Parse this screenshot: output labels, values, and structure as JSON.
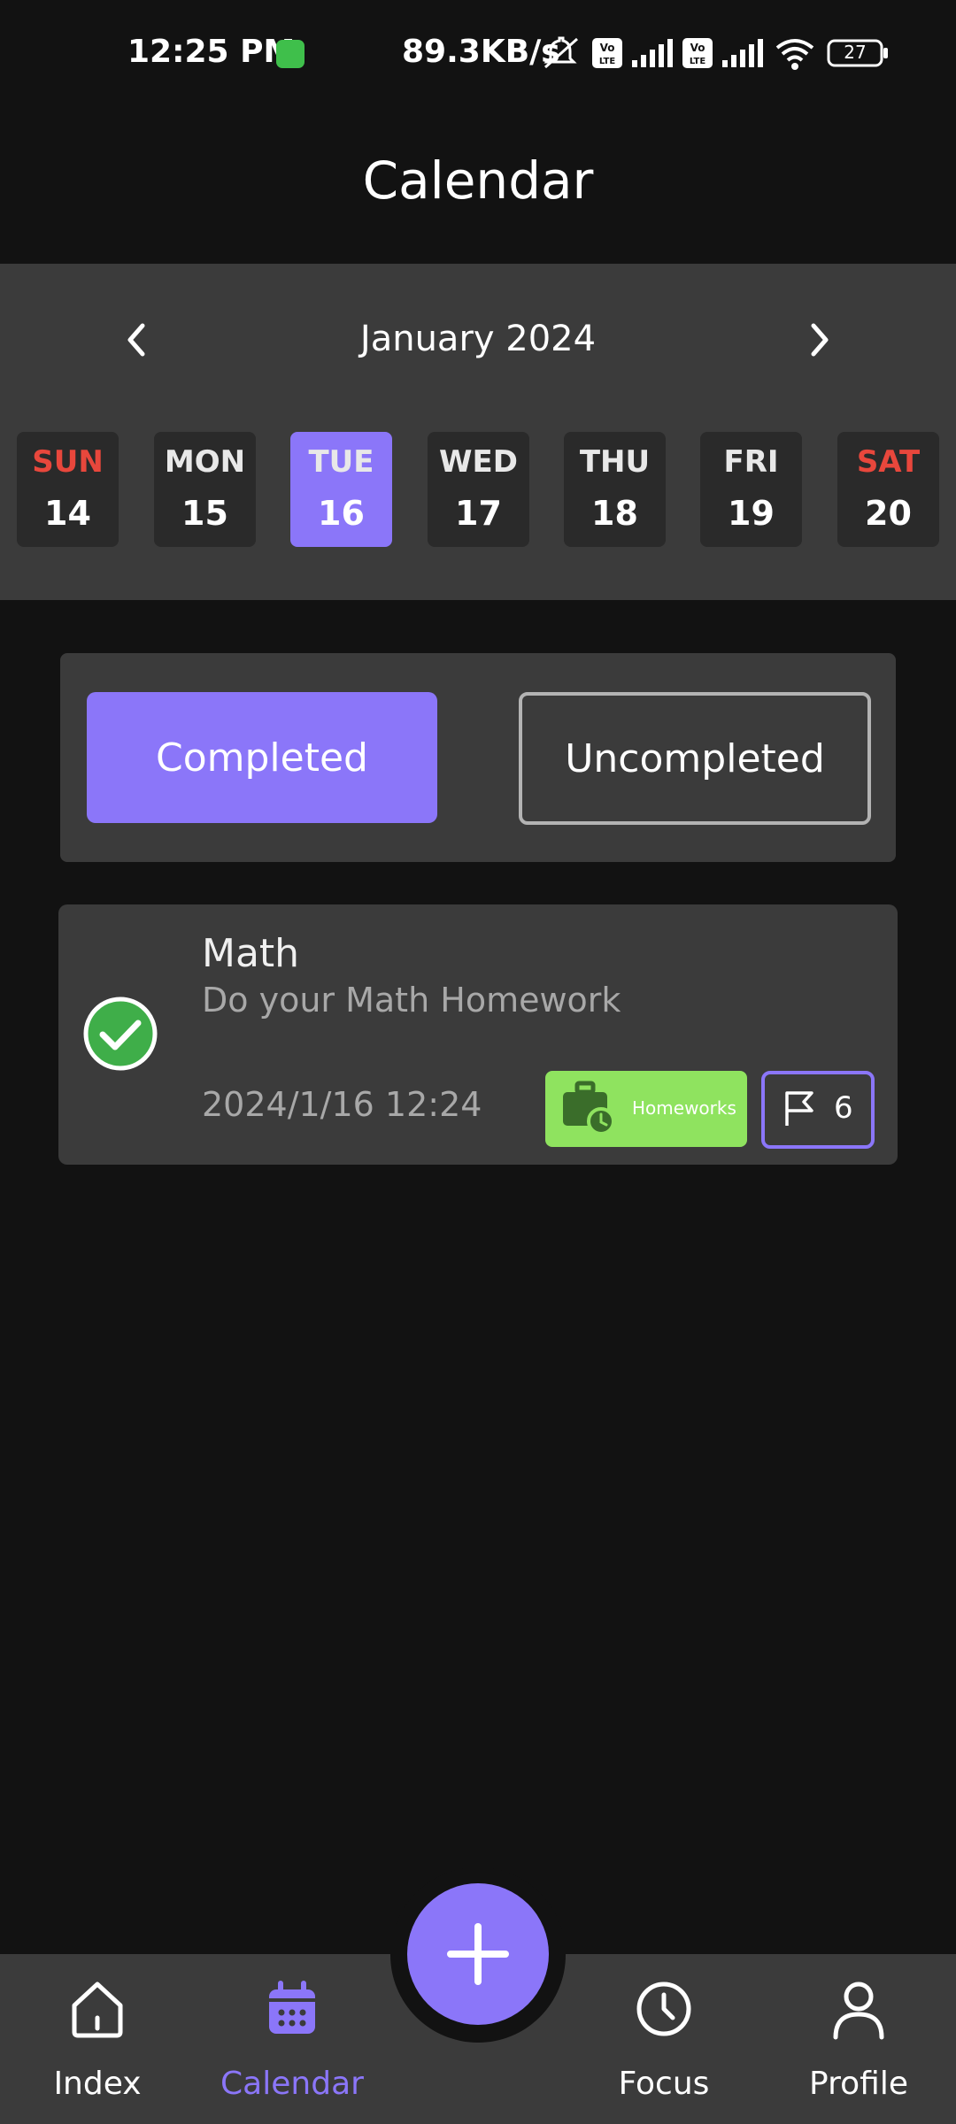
{
  "status_bar": {
    "time": "12:25 PM",
    "network_speed": "89.3KB/s",
    "battery": "27",
    "icons": [
      "mute-icon",
      "volte-icon",
      "signal-icon",
      "volte-icon",
      "signal-icon",
      "wifi-icon",
      "battery-icon"
    ]
  },
  "header": {
    "title": "Calendar"
  },
  "calendar": {
    "month_label": "January 2024",
    "prev_icon": "chevron-left-icon",
    "next_icon": "chevron-right-icon",
    "days": [
      {
        "name": "SUN",
        "num": "14"
      },
      {
        "name": "MON",
        "num": "15"
      },
      {
        "name": "TUE",
        "num": "16"
      },
      {
        "name": "WED",
        "num": "17"
      },
      {
        "name": "THU",
        "num": "18"
      },
      {
        "name": "FRI",
        "num": "19"
      },
      {
        "name": "SAT",
        "num": "20"
      }
    ],
    "selected_day": "TUE"
  },
  "filters": {
    "completed_label": "Completed",
    "uncompleted_label": "Uncompleted",
    "active": "Completed"
  },
  "tasks": [
    {
      "title": "Math",
      "description": "Do your Math Homework",
      "date": "2024/1/16 12:24",
      "category": "Homeworks",
      "category_icon": "briefcase-clock-icon",
      "priority": "6",
      "priority_icon": "flag-icon",
      "status_icon": "check-circle-icon"
    }
  ],
  "bottom_nav": {
    "items": [
      {
        "label": "Index",
        "icon": "home-icon"
      },
      {
        "label": "Calendar",
        "icon": "calendar-icon"
      },
      {
        "label": "Focus",
        "icon": "clock-icon"
      },
      {
        "label": "Profile",
        "icon": "user-icon"
      }
    ],
    "active": "Calendar",
    "fab_icon": "plus-icon"
  },
  "colors": {
    "accent": "#8b76f9",
    "background": "#121212",
    "surface": "#3b3b3b",
    "weekend": "#e8473c",
    "category": "#8fe35f",
    "check": "#3fae49"
  }
}
